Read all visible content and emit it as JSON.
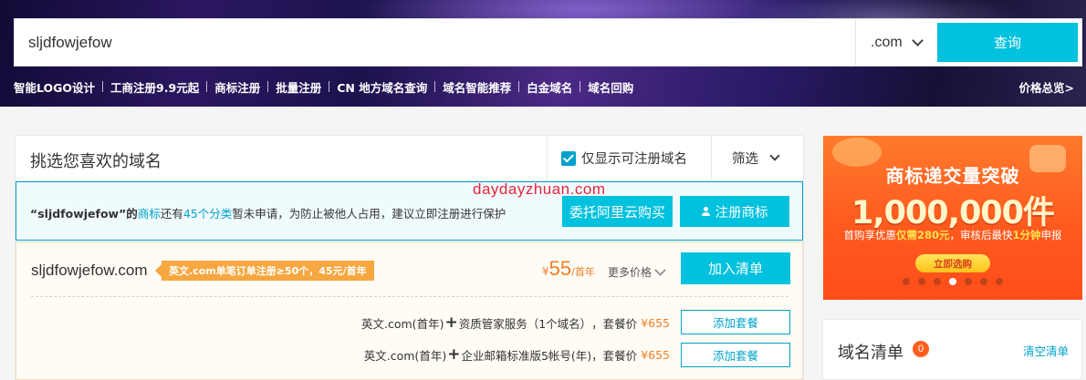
{
  "search": {
    "value": "sljdfowjefow",
    "suffix": ".com",
    "button": "查询"
  },
  "quick_links": [
    "智能LOGO设计",
    "工商注册9.9元起",
    "商标注册",
    "批量注册",
    "CN 地方域名查询",
    "域名智能推荐",
    "白金域名",
    "域名回购"
  ],
  "price_overview": "价格总览>",
  "panel": {
    "title": "挑选您喜欢的域名",
    "only_available": "仅显示可注册域名",
    "filter": "筛选"
  },
  "notice": {
    "quote_open": "“",
    "name": "sljdfowjefow",
    "quote_close": "”的",
    "trademark_word": "商标",
    "middle": "还有",
    "classes": "45个分类",
    "rest": "暂未申请，为防止被他人占用，建议立即注册进行保护",
    "watermark": "daydayzhuan.com",
    "entrust_button": "委托阿里云购买",
    "register_tm_button": "注册商标"
  },
  "result": {
    "domain": "sljdfowjefow.com",
    "promo": "英文.com单笔订单注册≥50个，45元/首年",
    "price_currency": "¥",
    "price_value": "55",
    "price_unit": "/首年",
    "more_prices": "更多价格",
    "add_to_cart": "加入清单",
    "packages": [
      {
        "prefix": "英文.com(首年)",
        "plus": "+",
        "item": "资质管家服务（1个域名）",
        "label": "，套餐价",
        "price": "¥655",
        "button": "添加套餐"
      },
      {
        "prefix": "英文.com(首年)",
        "plus": "+",
        "item": "企业邮箱标准版5帐号(年)",
        "label": "，套餐价",
        "price": "¥655",
        "button": "添加套餐"
      }
    ]
  },
  "banner": {
    "title": "商标递交量突破",
    "number": "1,000,000件",
    "sub_prefix": "首购享优惠",
    "sub_highlight1": "仅需280元",
    "sub_middle": "，审核后最快",
    "sub_highlight2": "1分钟",
    "sub_suffix": "申报",
    "cta": "立即选购",
    "slides": 7,
    "active_slide": 4
  },
  "cart": {
    "title": "域名清单",
    "count": "0",
    "clear": "清空清单"
  },
  "colors": {
    "accent": "#00c1de",
    "link": "#00a2ca",
    "price": "#f07f23",
    "promo_tag": "#f6a740",
    "badge": "#ff5f1f"
  }
}
